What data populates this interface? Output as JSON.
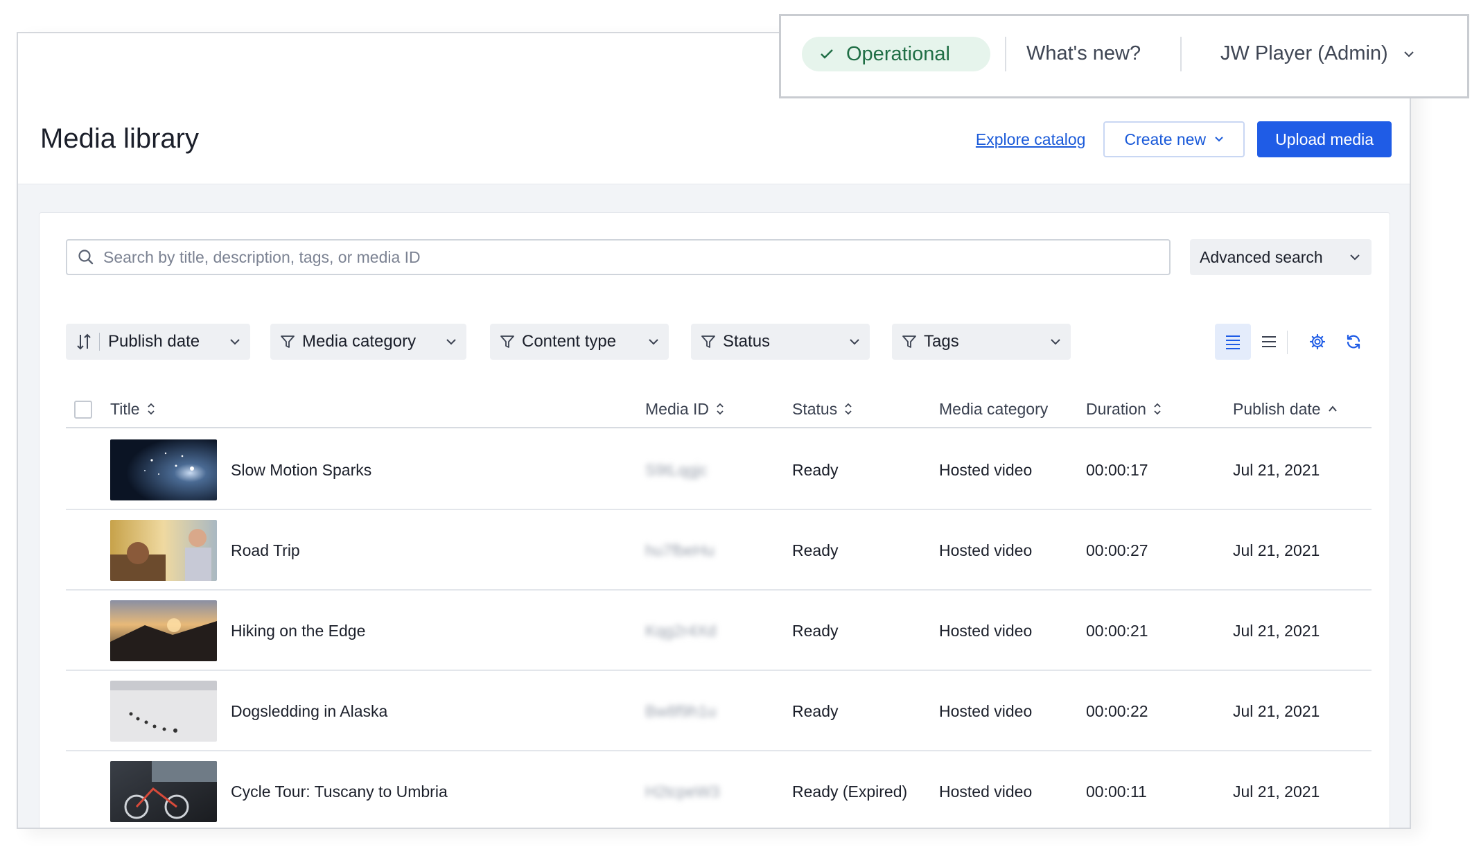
{
  "status_bar": {
    "status_label": "Operational",
    "whats_new": "What's new?",
    "account_label": "JW Player (Admin)"
  },
  "header": {
    "title": "Media library",
    "explore_label": "Explore catalog",
    "create_label": "Create new",
    "upload_label": "Upload media"
  },
  "search": {
    "placeholder": "Search by title, description, tags, or media ID",
    "value": "",
    "advanced_label": "Advanced search"
  },
  "filters": {
    "sort_label": "Publish date",
    "category_label": "Media category",
    "content_type_label": "Content type",
    "status_label": "Status",
    "tags_label": "Tags"
  },
  "table": {
    "columns": {
      "title": "Title",
      "media_id": "Media ID",
      "status": "Status",
      "category": "Media category",
      "duration": "Duration",
      "publish_date": "Publish date"
    },
    "rows": [
      {
        "title": "Slow Motion Sparks",
        "media_id": "S9tLqgjc",
        "status": "Ready",
        "category": "Hosted video",
        "duration": "00:00:17",
        "publish_date": "Jul 21, 2021"
      },
      {
        "title": "Road Trip",
        "media_id": "hu7fbeHu",
        "status": "Ready",
        "category": "Hosted video",
        "duration": "00:00:27",
        "publish_date": "Jul 21, 2021"
      },
      {
        "title": "Hiking on the Edge",
        "media_id": "Kqg2r4Xd",
        "status": "Ready",
        "category": "Hosted video",
        "duration": "00:00:21",
        "publish_date": "Jul 21, 2021"
      },
      {
        "title": "Dogsledding in Alaska",
        "media_id": "Bw8f9h1u",
        "status": "Ready",
        "category": "Hosted video",
        "duration": "00:00:22",
        "publish_date": "Jul 21, 2021"
      },
      {
        "title": "Cycle Tour: Tuscany to Umbria",
        "media_id": "H2tcpeW3",
        "status": "Ready (Expired)",
        "category": "Hosted video",
        "duration": "00:00:11",
        "publish_date": "Jul 21, 2021"
      }
    ]
  },
  "colors": {
    "primary": "#1f5ce6",
    "link": "#1a5ad9",
    "operational_bg": "#e6f4ec",
    "operational_text": "#1f6e45"
  },
  "icons": [
    "check-icon",
    "chevron-down-icon",
    "search-icon",
    "sort-icon",
    "filter-icon",
    "list-view-icon",
    "compact-view-icon",
    "gear-icon",
    "refresh-icon",
    "sort-arrows-icon",
    "sort-asc-icon"
  ]
}
